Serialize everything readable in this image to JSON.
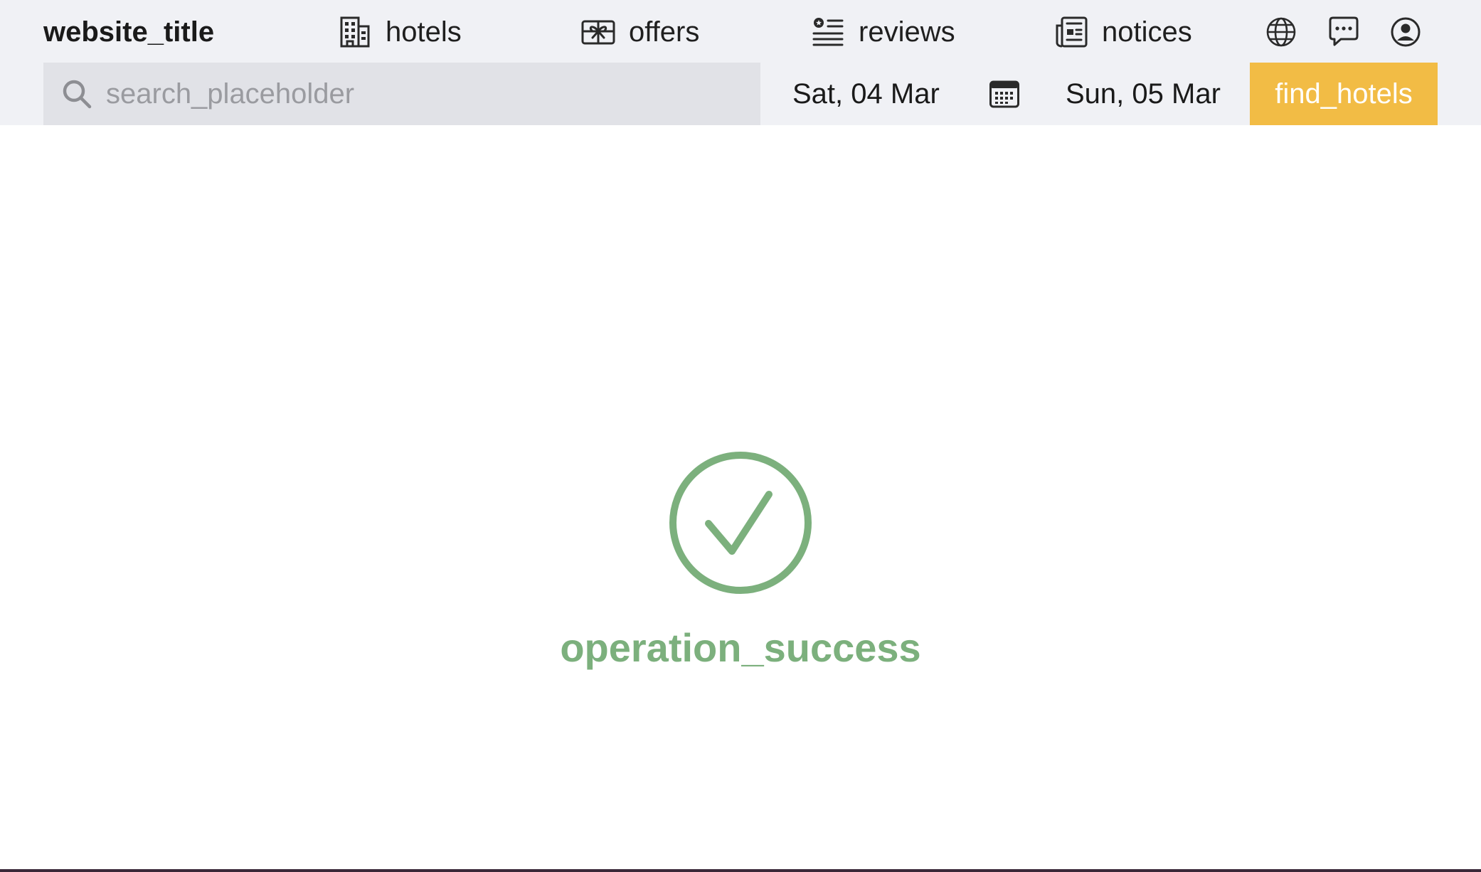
{
  "header": {
    "title": "website_title",
    "nav": [
      {
        "label": "hotels",
        "icon": "building-icon"
      },
      {
        "label": "offers",
        "icon": "gift-icon"
      },
      {
        "label": "reviews",
        "icon": "reviews-list-icon"
      },
      {
        "label": "notices",
        "icon": "newspaper-icon"
      }
    ],
    "utility_icons": [
      "globe-icon",
      "chat-icon",
      "account-icon"
    ]
  },
  "search": {
    "placeholder": "search_placeholder",
    "value": "",
    "checkin": "Sat, 04 Mar",
    "checkout": "Sun, 05 Mar",
    "button_label": "find_hotels"
  },
  "main": {
    "message": "operation_success",
    "icon": "check-circle-icon"
  },
  "colors": {
    "header_bg": "#f0f1f5",
    "search_bg": "#e1e2e7",
    "accent": "#f2bc45",
    "success": "#7cb07d"
  }
}
